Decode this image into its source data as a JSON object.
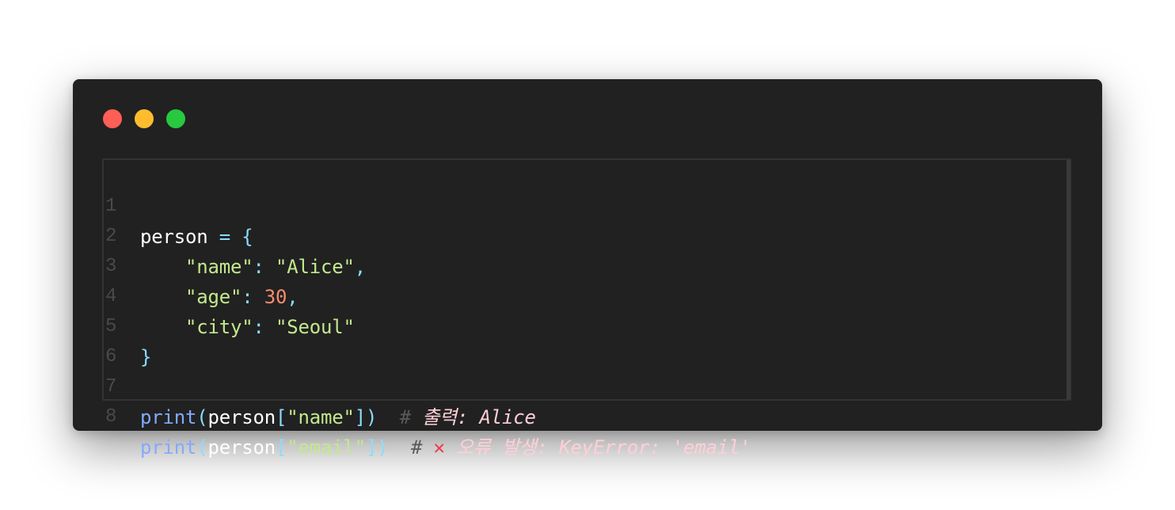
{
  "window": {
    "controls": [
      "close",
      "minimize",
      "maximize"
    ],
    "colors": {
      "close": "#ff5f56",
      "minimize": "#ffbd2e",
      "maximize": "#27c93f"
    }
  },
  "editor": {
    "line_numbers": [
      "1",
      "2",
      "3",
      "4",
      "5",
      "6",
      "7",
      "8"
    ],
    "tokens": {
      "l1_var": "person",
      "l1_eq": " = ",
      "l1_brace": "{",
      "l2_indent": "    ",
      "l2_key": "\"name\"",
      "l2_colon": ": ",
      "l2_val": "\"Alice\"",
      "l2_comma": ",",
      "l3_indent": "    ",
      "l3_key": "\"age\"",
      "l3_colon": ": ",
      "l3_val": "30",
      "l3_comma": ",",
      "l4_indent": "    ",
      "l4_key": "\"city\"",
      "l4_colon": ": ",
      "l4_val": "\"Seoul\"",
      "l5_brace": "}",
      "l7_fn": "print",
      "l7_paren_open": "(",
      "l7_var": "person",
      "l7_bracket_open": "[",
      "l7_key": "\"name\"",
      "l7_close": "])",
      "l7_hash": "  # ",
      "l7_comment": "출력: Alice",
      "l8_fn": "print",
      "l8_paren_open": "(",
      "l8_var": "person",
      "l8_bracket_open": "[",
      "l8_key": "\"email\"",
      "l8_close": "])",
      "l8_hash": "  # ",
      "l8_icon": "✕",
      "l8_comment": " 오류 발생: KeyError: 'email'"
    }
  },
  "theme": {
    "background": "#212121",
    "string": "#c3e88d",
    "number": "#f78c6c",
    "function": "#82aaff",
    "punctuation": "#89ddff",
    "comment": "#ffcfd8",
    "error_icon": "#f4364c"
  }
}
